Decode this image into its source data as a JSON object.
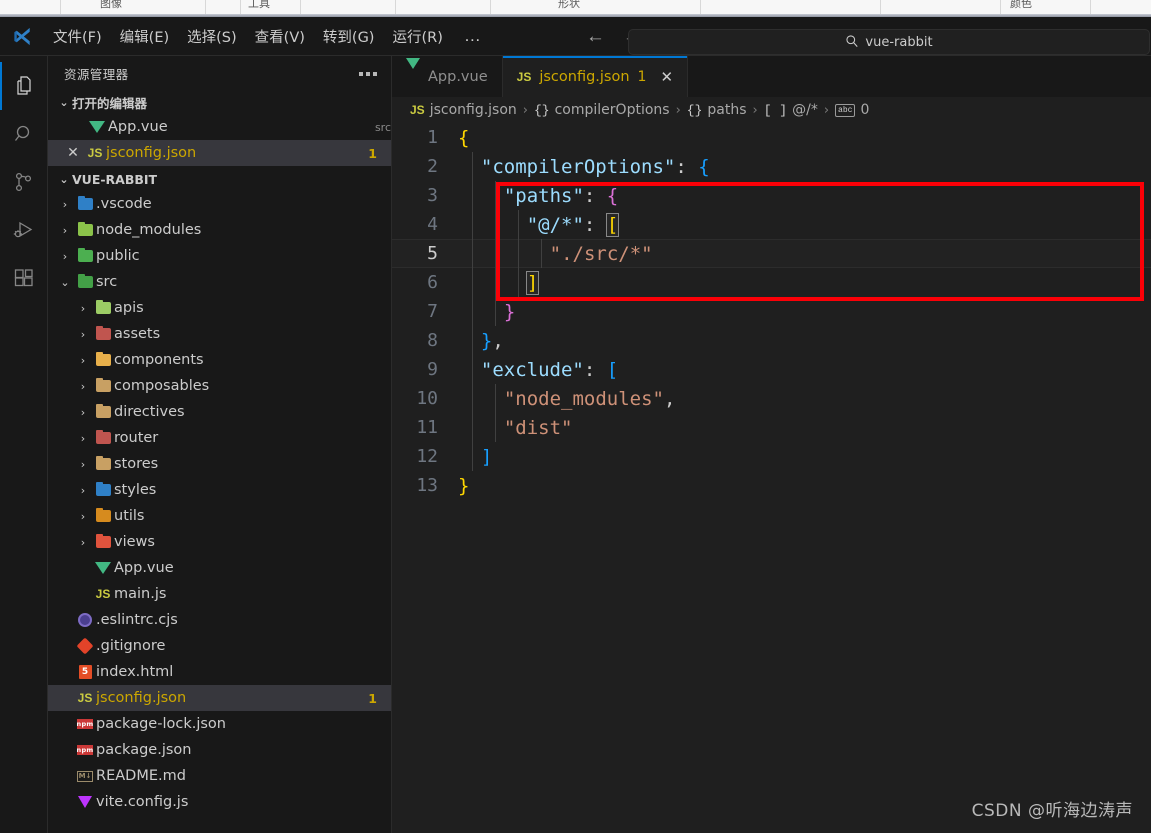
{
  "external_toolbar": {
    "labels": [
      "图像",
      "工具",
      "形状",
      "颜色"
    ]
  },
  "titlebar": {
    "logo_name": "vscode-logo-icon",
    "menus": [
      "文件(F)",
      "编辑(E)",
      "选择(S)",
      "查看(V)",
      "转到(G)",
      "运行(R)"
    ],
    "more_label": "…",
    "back_arrow": "←",
    "forward_arrow": "→",
    "command_center": {
      "search_icon": "search-icon",
      "value": "vue-rabbit"
    }
  },
  "activitybar": {
    "items": [
      {
        "name": "explorer",
        "icon": "files-icon",
        "active": true
      },
      {
        "name": "search",
        "icon": "search-icon",
        "active": false
      },
      {
        "name": "source-control",
        "icon": "source-control-icon",
        "active": false
      },
      {
        "name": "run-debug",
        "icon": "run-and-debug-icon",
        "active": false
      },
      {
        "name": "extensions",
        "icon": "extensions-icon",
        "active": false
      }
    ]
  },
  "sidebar": {
    "title": "资源管理器",
    "more_actions": "views-and-more-actions-icon",
    "open_editors": {
      "label": "打开的编辑器",
      "expanded": true,
      "items": [
        {
          "name": "App.vue",
          "sub": "src",
          "icon": "vue-icon",
          "badge": "",
          "selected": false,
          "show_close": false
        },
        {
          "name": "jsconfig.json",
          "sub": "",
          "icon": "js-icon",
          "badge": "1",
          "selected": true,
          "show_close": true
        }
      ]
    },
    "workspace": {
      "label": "VUE-RABBIT",
      "expanded": true,
      "tree": [
        {
          "label": ".vscode",
          "type": "folder",
          "icon": "vscode-folder-icon",
          "depth": 1,
          "expanded": false,
          "badge": ""
        },
        {
          "label": "node_modules",
          "type": "folder",
          "icon": "node-folder-icon",
          "depth": 1,
          "expanded": false,
          "badge": ""
        },
        {
          "label": "public",
          "type": "folder",
          "icon": "public-folder-icon",
          "depth": 1,
          "expanded": false,
          "badge": ""
        },
        {
          "label": "src",
          "type": "folder",
          "icon": "src-folder-icon",
          "depth": 1,
          "expanded": true,
          "badge": ""
        },
        {
          "label": "apis",
          "type": "folder",
          "icon": "api-folder-icon",
          "depth": 2,
          "expanded": false,
          "badge": ""
        },
        {
          "label": "assets",
          "type": "folder",
          "icon": "assets-folder-icon",
          "depth": 2,
          "expanded": false,
          "badge": ""
        },
        {
          "label": "components",
          "type": "folder",
          "icon": "components-folder-icon",
          "depth": 2,
          "expanded": false,
          "badge": ""
        },
        {
          "label": "composables",
          "type": "folder",
          "icon": "folder-icon",
          "depth": 2,
          "expanded": false,
          "badge": ""
        },
        {
          "label": "directives",
          "type": "folder",
          "icon": "folder-icon",
          "depth": 2,
          "expanded": false,
          "badge": ""
        },
        {
          "label": "router",
          "type": "folder",
          "icon": "router-folder-icon",
          "depth": 2,
          "expanded": false,
          "badge": ""
        },
        {
          "label": "stores",
          "type": "folder",
          "icon": "folder-icon",
          "depth": 2,
          "expanded": false,
          "badge": ""
        },
        {
          "label": "styles",
          "type": "folder",
          "icon": "css-folder-icon",
          "depth": 2,
          "expanded": false,
          "badge": ""
        },
        {
          "label": "utils",
          "type": "folder",
          "icon": "utils-folder-icon",
          "depth": 2,
          "expanded": false,
          "badge": ""
        },
        {
          "label": "views",
          "type": "folder",
          "icon": "views-folder-icon",
          "depth": 2,
          "expanded": false,
          "badge": ""
        },
        {
          "label": "App.vue",
          "type": "file",
          "icon": "vue-icon",
          "depth": 2,
          "badge": ""
        },
        {
          "label": "main.js",
          "type": "file",
          "icon": "js-icon",
          "depth": 2,
          "badge": ""
        },
        {
          "label": ".eslintrc.cjs",
          "type": "file",
          "icon": "eslint-icon",
          "depth": 1,
          "badge": ""
        },
        {
          "label": ".gitignore",
          "type": "file",
          "icon": "git-icon",
          "depth": 1,
          "badge": ""
        },
        {
          "label": "index.html",
          "type": "file",
          "icon": "html-icon",
          "depth": 1,
          "badge": ""
        },
        {
          "label": "jsconfig.json",
          "type": "file",
          "icon": "js-icon",
          "depth": 1,
          "badge": "1",
          "selected": true,
          "modified": true
        },
        {
          "label": "package-lock.json",
          "type": "file",
          "icon": "npm-icon",
          "depth": 1,
          "badge": ""
        },
        {
          "label": "package.json",
          "type": "file",
          "icon": "npm-icon",
          "depth": 1,
          "badge": ""
        },
        {
          "label": "README.md",
          "type": "file",
          "icon": "markdown-icon",
          "depth": 1,
          "badge": ""
        },
        {
          "label": "vite.config.js",
          "type": "file",
          "icon": "vite-icon",
          "depth": 1,
          "badge": ""
        }
      ]
    }
  },
  "editor": {
    "tabs": [
      {
        "label": "App.vue",
        "icon": "vue-icon",
        "count": "",
        "active": false,
        "closable": false
      },
      {
        "label": "jsconfig.json",
        "icon": "js-icon",
        "count": "1",
        "active": true,
        "closable": true
      }
    ],
    "close_icon": "close-icon",
    "breadcrumb": [
      {
        "icon": "js-icon",
        "symbol": "",
        "label": "jsconfig.json"
      },
      {
        "icon": "",
        "symbol": "{}",
        "label": "compilerOptions"
      },
      {
        "icon": "",
        "symbol": "{}",
        "label": "paths"
      },
      {
        "icon": "",
        "symbol": "[ ]",
        "label": "@/*"
      },
      {
        "icon": "",
        "symbol": "abc",
        "label": "0"
      }
    ],
    "breadcrumb_separator": "›",
    "active_line": 5,
    "lines": [
      {
        "n": "1",
        "text": "{"
      },
      {
        "n": "2",
        "text": "  \"compilerOptions\": {"
      },
      {
        "n": "3",
        "text": "    \"paths\": {"
      },
      {
        "n": "4",
        "text": "      \"@/*\": ["
      },
      {
        "n": "5",
        "text": "        \"./src/*\""
      },
      {
        "n": "6",
        "text": "      ]"
      },
      {
        "n": "7",
        "text": "    }"
      },
      {
        "n": "8",
        "text": "  },"
      },
      {
        "n": "9",
        "text": "  \"exclude\": ["
      },
      {
        "n": "10",
        "text": "    \"node_modules\","
      },
      {
        "n": "11",
        "text": "    \"dist\""
      },
      {
        "n": "12",
        "text": "  ]"
      },
      {
        "n": "13",
        "text": "}"
      }
    ],
    "annotation": {
      "name": "red-highlight-rect",
      "color": "#fb0007"
    }
  },
  "watermark": "CSDN @听海边涛声",
  "colors": {
    "accent": "#0078d4",
    "modified_yellow": "#cca700",
    "editor_bg": "#1f1f1f",
    "sidebar_bg": "#181818",
    "selection_bg": "#37373d",
    "annotation_red": "#fb0007"
  }
}
